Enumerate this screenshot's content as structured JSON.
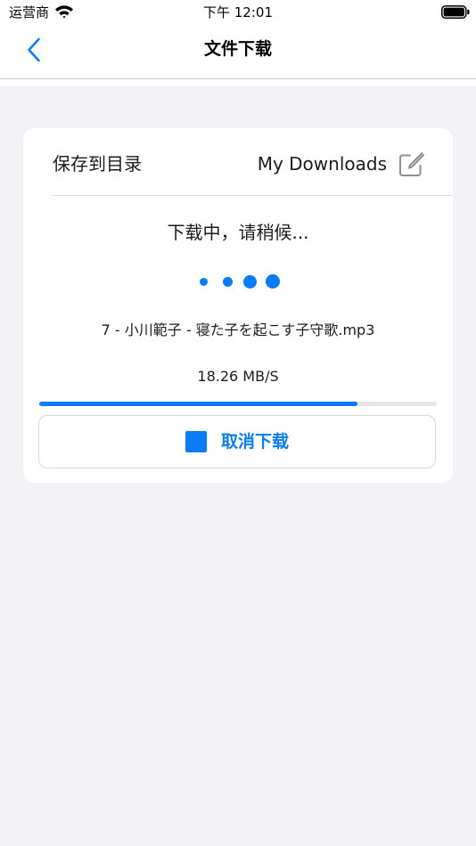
{
  "status_bar": {
    "carrier": "运营商",
    "time": "下午 12:01",
    "icons": [
      "wifi-icon",
      "battery-icon"
    ]
  },
  "nav": {
    "title": "文件下载",
    "back_icon": "chevron-left-icon"
  },
  "download": {
    "save_label": "保存到目录",
    "save_dir": "My Downloads",
    "edit_icon": "edit-icon",
    "status": "下载中，请稍候...",
    "filename": "7 - 小川範子 - 寝た子を起こす子守歌.mp3",
    "speed": "18.26 MB/S",
    "progress": 0.8,
    "cancel_label": "取消下载",
    "cancel_icon": "stop-icon"
  },
  "colors": {
    "accent": "#0a7cf5",
    "background": "#f2f2f7",
    "card": "#ffffff"
  }
}
